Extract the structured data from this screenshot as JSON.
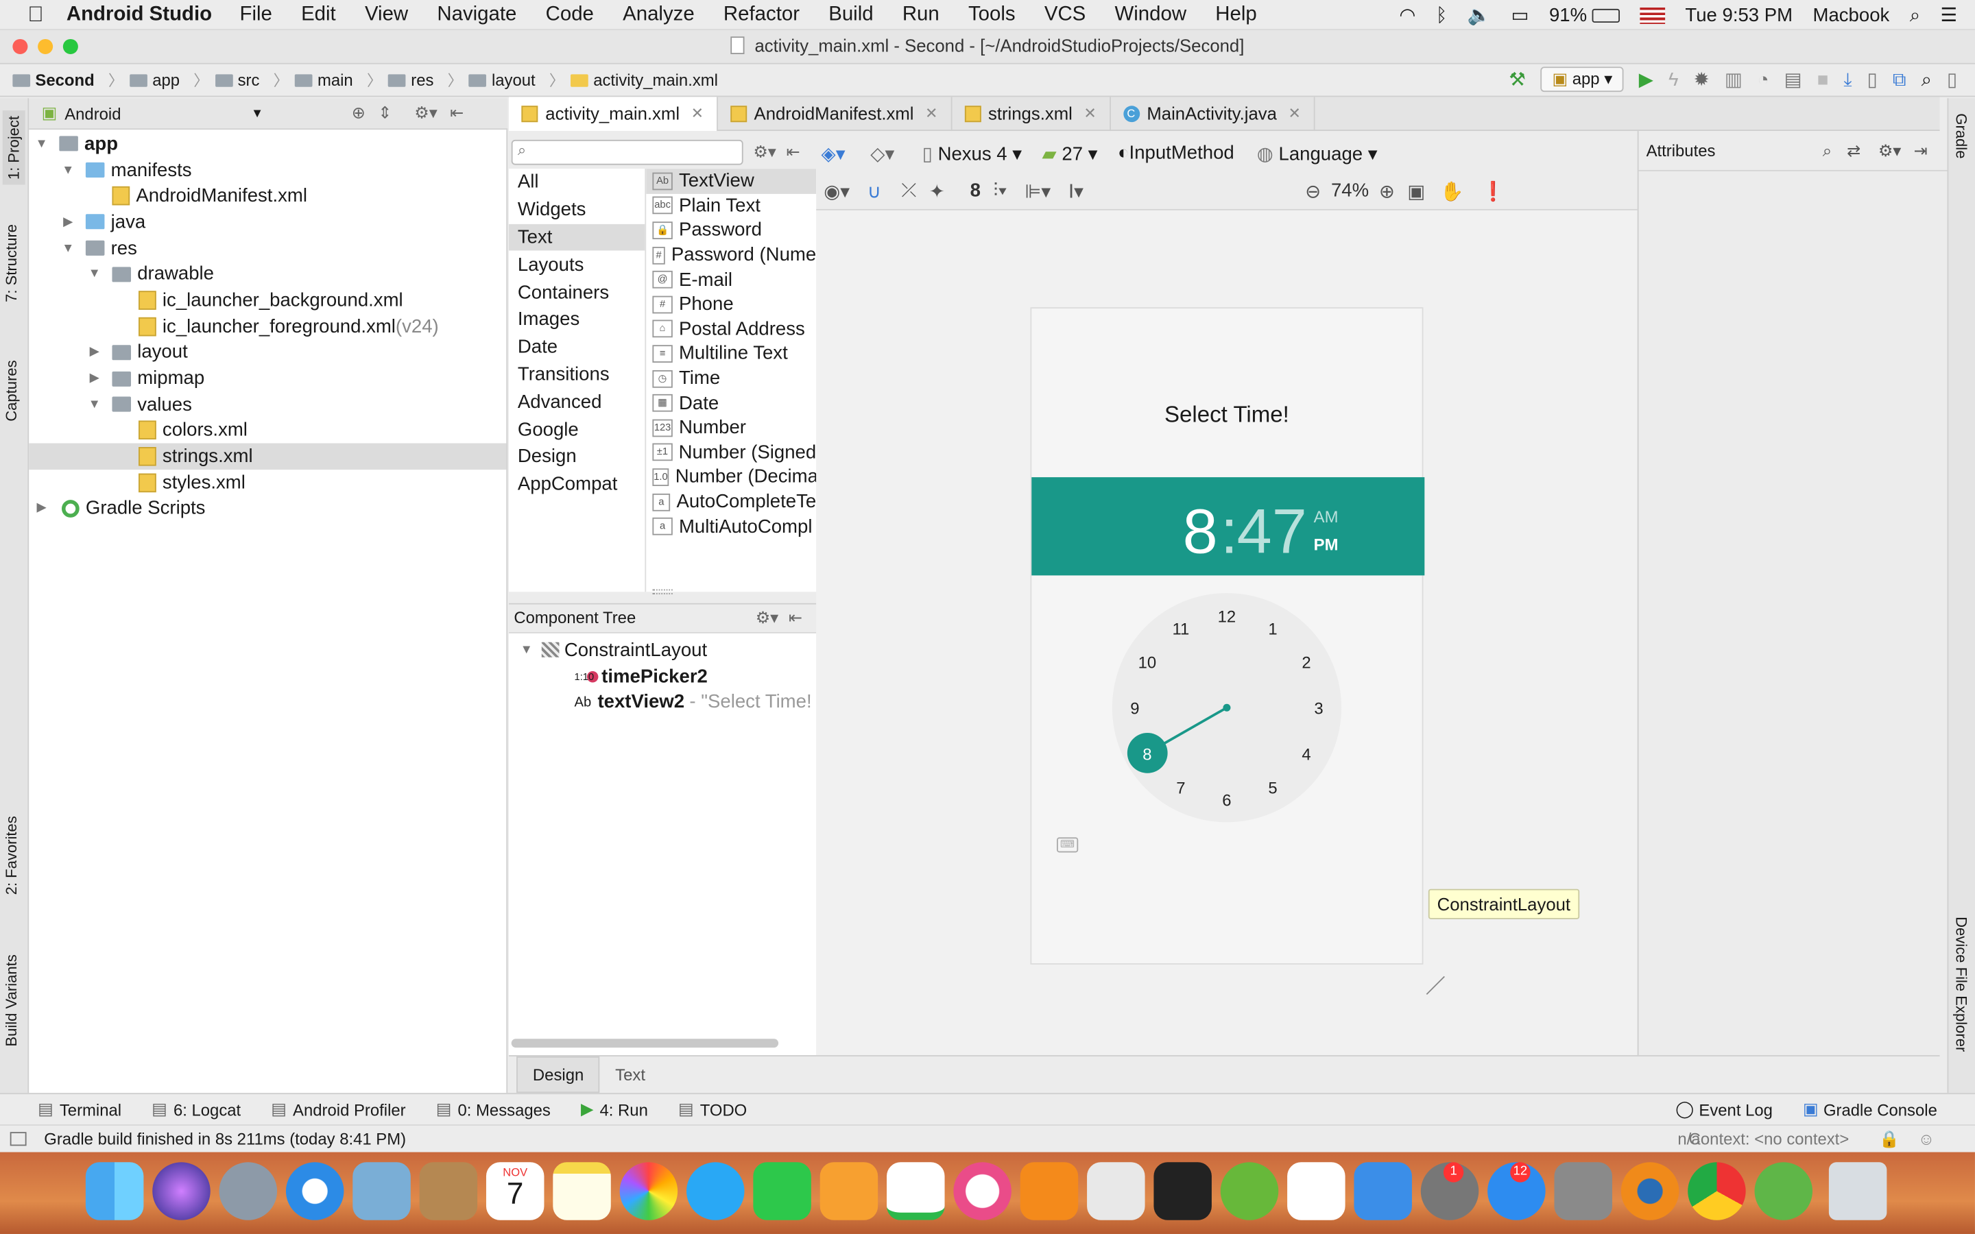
{
  "menubar": {
    "app": "Android Studio",
    "items": [
      "File",
      "Edit",
      "View",
      "Navigate",
      "Code",
      "Analyze",
      "Refactor",
      "Build",
      "Run",
      "Tools",
      "VCS",
      "Window",
      "Help"
    ],
    "battery": "91%",
    "clock": "Tue 9:53 PM",
    "user": "Macbook"
  },
  "window": {
    "title": "activity_main.xml - Second - [~/AndroidStudioProjects/Second]"
  },
  "breadcrumb": [
    "Second",
    "app",
    "src",
    "main",
    "res",
    "layout",
    "activity_main.xml"
  ],
  "run_config": "app",
  "project": {
    "view": "Android",
    "tree": [
      {
        "label": "app",
        "level": 0,
        "arrow": "▼",
        "bold": true
      },
      {
        "label": "manifests",
        "level": 1,
        "arrow": "▼"
      },
      {
        "label": "AndroidManifest.xml",
        "level": 2,
        "arrow": ""
      },
      {
        "label": "java",
        "level": 1,
        "arrow": "▶"
      },
      {
        "label": "res",
        "level": 1,
        "arrow": "▼"
      },
      {
        "label": "drawable",
        "level": 2,
        "arrow": "▼"
      },
      {
        "label": "ic_launcher_background.xml",
        "level": 3,
        "arrow": ""
      },
      {
        "label": "ic_launcher_foreground.xml",
        "level": 3,
        "arrow": "",
        "suffix": "(v24)"
      },
      {
        "label": "layout",
        "level": 2,
        "arrow": "▶"
      },
      {
        "label": "mipmap",
        "level": 2,
        "arrow": "▶"
      },
      {
        "label": "values",
        "level": 2,
        "arrow": "▼"
      },
      {
        "label": "colors.xml",
        "level": 3,
        "arrow": ""
      },
      {
        "label": "strings.xml",
        "level": 3,
        "arrow": "",
        "selected": true
      },
      {
        "label": "styles.xml",
        "level": 3,
        "arrow": ""
      },
      {
        "label": "Gradle Scripts",
        "level": 0,
        "arrow": "▶"
      }
    ]
  },
  "editor_tabs": [
    "activity_main.xml",
    "AndroidManifest.xml",
    "strings.xml",
    "MainActivity.java"
  ],
  "palette": {
    "categories": [
      "All",
      "Widgets",
      "Text",
      "Layouts",
      "Containers",
      "Images",
      "Date",
      "Transitions",
      "Advanced",
      "Google",
      "Design",
      "AppCompat"
    ],
    "selected_category": "Text",
    "items": [
      {
        "icon": "Ab",
        "label": "TextView"
      },
      {
        "icon": "abc",
        "label": "Plain Text"
      },
      {
        "icon": "🔒",
        "label": "Password"
      },
      {
        "icon": "#",
        "label": "Password (Nume"
      },
      {
        "icon": "@",
        "label": "E-mail"
      },
      {
        "icon": "#",
        "label": "Phone"
      },
      {
        "icon": "⌂",
        "label": "Postal Address"
      },
      {
        "icon": "≡",
        "label": "Multiline Text"
      },
      {
        "icon": "◷",
        "label": "Time"
      },
      {
        "icon": "▦",
        "label": "Date"
      },
      {
        "icon": "123",
        "label": "Number"
      },
      {
        "icon": "±1",
        "label": "Number (Signed"
      },
      {
        "icon": "1.0",
        "label": "Number (Decima"
      },
      {
        "icon": "a",
        "label": "AutoCompleteTe"
      },
      {
        "icon": "a",
        "label": "MultiAutoCompl"
      }
    ]
  },
  "component_tree": {
    "title": "Component Tree",
    "root": "ConstraintLayout",
    "children": [
      {
        "icon": "1:10",
        "label": "timePicker2",
        "hint": ""
      },
      {
        "icon": "Ab",
        "label": "textView2",
        "hint": "- \"Select Time!"
      }
    ]
  },
  "design_toolbar": {
    "device": "Nexus 4",
    "api": "27",
    "theme": "InputMethod",
    "language": "Language",
    "margin": "8",
    "zoom": "74%"
  },
  "preview": {
    "heading": "Select Time!",
    "hour": "8",
    "colon": ":",
    "minute": "47",
    "am": "AM",
    "pm": "PM",
    "clock_numbers": [
      "12",
      "1",
      "2",
      "3",
      "4",
      "5",
      "6",
      "7",
      "8",
      "9",
      "10",
      "11"
    ],
    "selected_hour": "8",
    "accent": "#199889"
  },
  "tooltip": "ConstraintLayout",
  "attributes": {
    "title": "Attributes"
  },
  "side_tabs": {
    "left": [
      "1: Project",
      "7: Structure",
      "Captures",
      "2: Favorites",
      "Build Variants"
    ],
    "right": [
      "Gradle",
      "Device File Explorer"
    ]
  },
  "design_tabs": [
    "Design",
    "Text"
  ],
  "tool_windows": [
    "Terminal",
    "6: Logcat",
    "Android Profiler",
    "0: Messages",
    "4: Run",
    "TODO"
  ],
  "tool_windows_right": [
    "Event Log",
    "Gradle Console"
  ],
  "status": {
    "message": "Gradle build finished in 8s 211ms (today 8:41 PM)",
    "na": "n/a",
    "context": "Context: <no context>"
  },
  "dock": {
    "badges": {
      "messages": "",
      "appstore": "12",
      "sysprefs": "1"
    },
    "calendar_month": "NOV",
    "calendar_day": "7"
  }
}
